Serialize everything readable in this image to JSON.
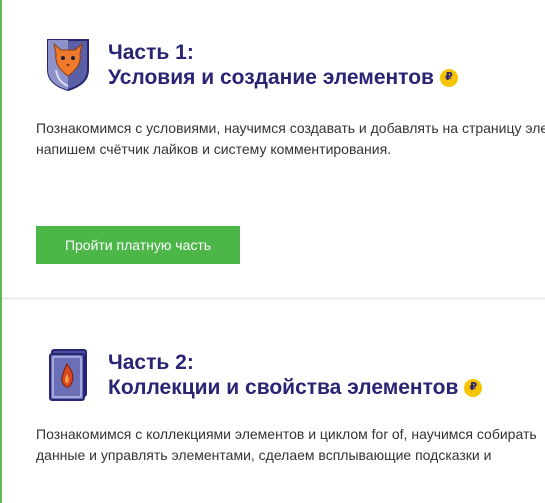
{
  "part1": {
    "icon": "cat-shield-icon",
    "title_line1": "Часть 1:",
    "title_line2": "Условия и создание элементов",
    "coin_symbol": "₽",
    "description_line1": "Познакомимся с условиями, научимся создавать и добавлять на страницу элементы,",
    "description_line2": "напишем счётчик лайков и систему комментирования.",
    "button_label": "Пройти платную часть"
  },
  "part2": {
    "icon": "book-flame-icon",
    "title_line1": "Часть 2:",
    "title_line2": "Коллекции и свойства элементов",
    "coin_symbol": "₽",
    "description_line1": "Познакомимся с коллекциями элементов и циклом for of, научимся собирать",
    "description_line2": "данные и управлять элементами, сделаем всплывающие подсказки и"
  },
  "colors": {
    "title": "#2a2474",
    "accent_green": "#4cb648",
    "coin": "#f6c400",
    "text": "#333333"
  }
}
